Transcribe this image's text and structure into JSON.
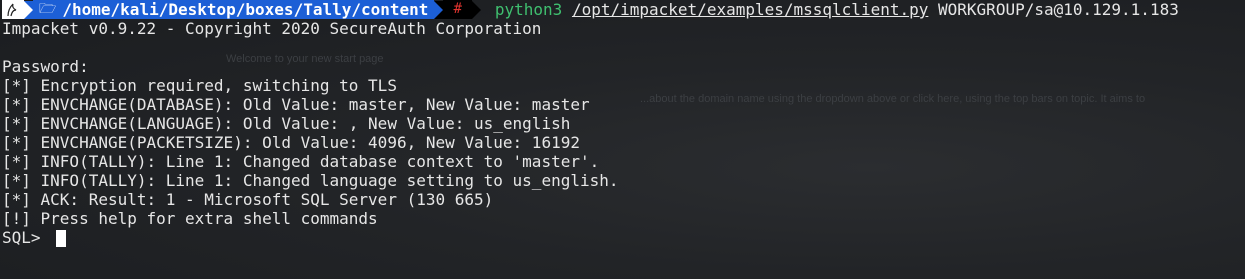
{
  "prompt": {
    "os_icon": "kali-logo-icon",
    "folder_icon": "folder-icon",
    "path_prefix": "/home/kali/Desktop/boxes/Tally/",
    "path_current": "content",
    "status_symbol": "#",
    "command": "python3",
    "script_path": "/opt/impacket/examples/mssqlclient.py",
    "argument": "WORKGROUP/sa@10.129.1.183"
  },
  "output_lines": [
    "Impacket v0.9.22 - Copyright 2020 SecureAuth Corporation",
    "",
    "Password:",
    "[*] Encryption required, switching to TLS",
    "[*] ENVCHANGE(DATABASE): Old Value: master, New Value: master",
    "[*] ENVCHANGE(LANGUAGE): Old Value: , New Value: us_english",
    "[*] ENVCHANGE(PACKETSIZE): Old Value: 4096, New Value: 16192",
    "[*] INFO(TALLY): Line 1: Changed database context to 'master'.",
    "[*] INFO(TALLY): Line 1: Changed language setting to us_english.",
    "[*] ACK: Result: 1 - Microsoft SQL Server (130 665)",
    "[!] Press help for extra shell commands"
  ],
  "sql_prompt": "SQL> ",
  "colors": {
    "path_bg": "#1c5fd6",
    "status_red": "#e0342f",
    "command_green": "#3fbf6f",
    "background": "#1e2023"
  }
}
